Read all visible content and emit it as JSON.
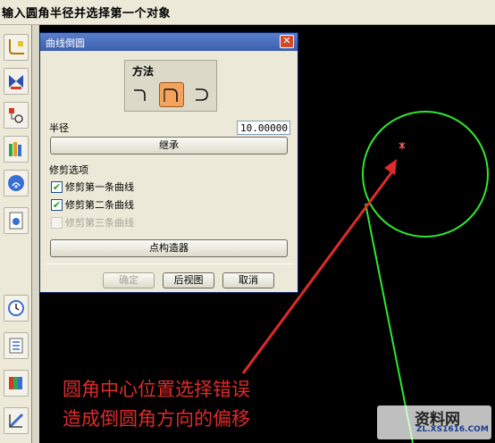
{
  "status": {
    "prompt": "输入圆角半径并选择第一个对象"
  },
  "toolbar": {
    "icons": [
      "fillet-curve-icon",
      "trim-curve-icon",
      "point-icon",
      "layers-icon",
      "wifi-icon",
      "document-icon",
      "clock-icon",
      "table-icon",
      "color-palette-icon",
      "measure-icon"
    ]
  },
  "dialog": {
    "title": "曲线倒圆",
    "method_label": "方法",
    "methods": [
      "simple-fillet",
      "two-curve-fillet",
      "three-curve-fillet"
    ],
    "selected_method": "two-curve-fillet",
    "radius_label": "半径",
    "radius_value": "10.00000",
    "inherit_button": "继承",
    "trim_options_label": "修剪选项",
    "trim_options": [
      {
        "label": "修剪第一条曲线",
        "checked": true,
        "enabled": true
      },
      {
        "label": "修剪第二条曲线",
        "checked": true,
        "enabled": true
      },
      {
        "label": "修剪第三条曲线",
        "checked": false,
        "enabled": false
      }
    ],
    "point_constructor_button": "点构造器",
    "ok_button": "确定",
    "back_button": "后视图",
    "cancel_button": "取消"
  },
  "annotation": {
    "line1": "圆角中心位置选择错误",
    "line2": "造成倒圆角方向的偏移",
    "color": "#e02a2a"
  },
  "watermark": {
    "logo": "",
    "title": "资料网",
    "url": "ZL.XS1616.COM"
  },
  "colors": {
    "curve": "#2ee82e",
    "arrow": "#e02a2a",
    "center_mark": "#ff6666",
    "dialog_title": "#3c5fae",
    "selected_method": "#f3a35c"
  }
}
